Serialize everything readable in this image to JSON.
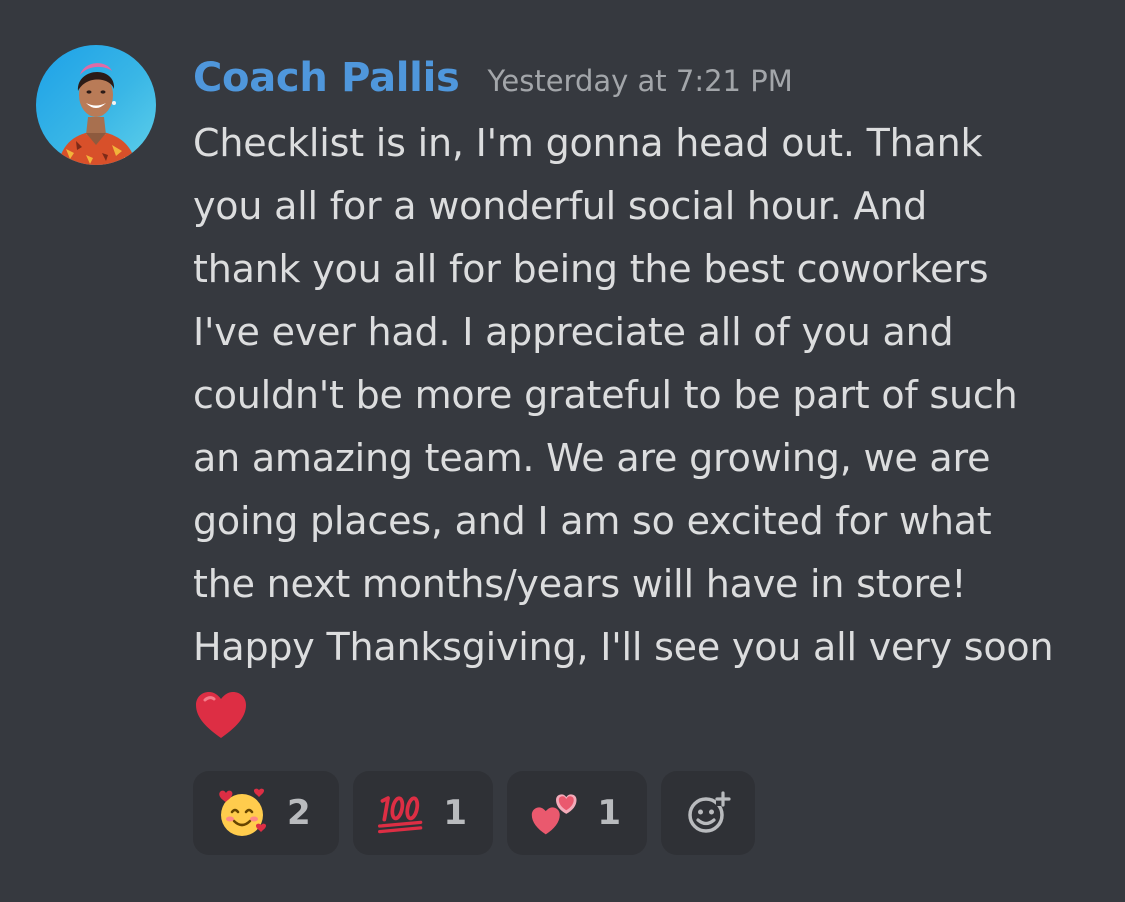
{
  "message": {
    "username": "Coach Pallis",
    "timestamp": "Yesterday at 7:21 PM",
    "content_lines": [
      "Checklist is in, I'm gonna head out. Thank",
      "you all for a wonderful social hour. And",
      "thank you all for being the best coworkers",
      "I've ever had. I appreciate all of you and",
      "couldn't be more grateful to be part of such",
      "an amazing team. We are growing, we are",
      "going places, and I am so excited for what",
      "the next months/years will have in store!",
      "Happy Thanksgiving, I'll see you all very soon"
    ],
    "trailing_emoji": "red-heart"
  },
  "reactions": [
    {
      "emoji": "smiling-face-with-hearts",
      "count": "2"
    },
    {
      "emoji": "hundred-points",
      "count": "1"
    },
    {
      "emoji": "two-hearts",
      "count": "1"
    }
  ],
  "add_reaction_icon": "add-reaction-icon",
  "colors": {
    "background": "#36393f",
    "username": "#4f97dc",
    "timestamp": "#a3a6aa",
    "text": "#dcddde",
    "reaction_bg": "#2f3136"
  }
}
